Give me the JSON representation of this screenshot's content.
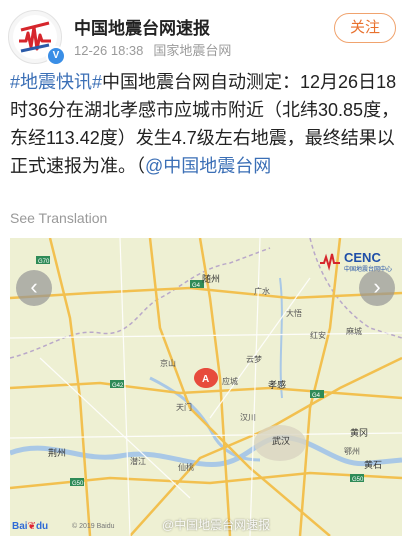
{
  "account": {
    "name": "中国地震台网速报",
    "time": "12-26 18:38",
    "source": "国家地震台网",
    "follow_label": "关注",
    "verified_mark": "V",
    "brand_color": "#e8712e"
  },
  "post": {
    "hashtag": "#地震快讯#",
    "text": "中国地震台网自动测定：12月26日18时36分在湖北孝感市应城市附近（北纬30.85度，东经113.42度）发生4.7级左右地震，最终结果以正式速报为准。（",
    "mention": "@中国地震台网",
    "link_color": "#3b6fb6"
  },
  "translation": {
    "label": "See Translation"
  },
  "map": {
    "logo_text": "CENC",
    "logo_sub": "中国地震台网中心",
    "epicenter_marker": "A",
    "baidu_label_a": "Bai",
    "baidu_label_b": "du",
    "copyright": "© 2019 Baidu",
    "watermark": "@中国地震台网速报",
    "nav_prev_icon": "‹",
    "nav_next_icon": "›",
    "places": [
      "随州",
      "广水",
      "大悟",
      "红安",
      "孝感",
      "麻城",
      "京山",
      "应城",
      "云梦",
      "天门",
      "汉川",
      "武汉",
      "黄冈",
      "荆州",
      "仙桃",
      "潜江",
      "鄂州",
      "黄石"
    ]
  }
}
